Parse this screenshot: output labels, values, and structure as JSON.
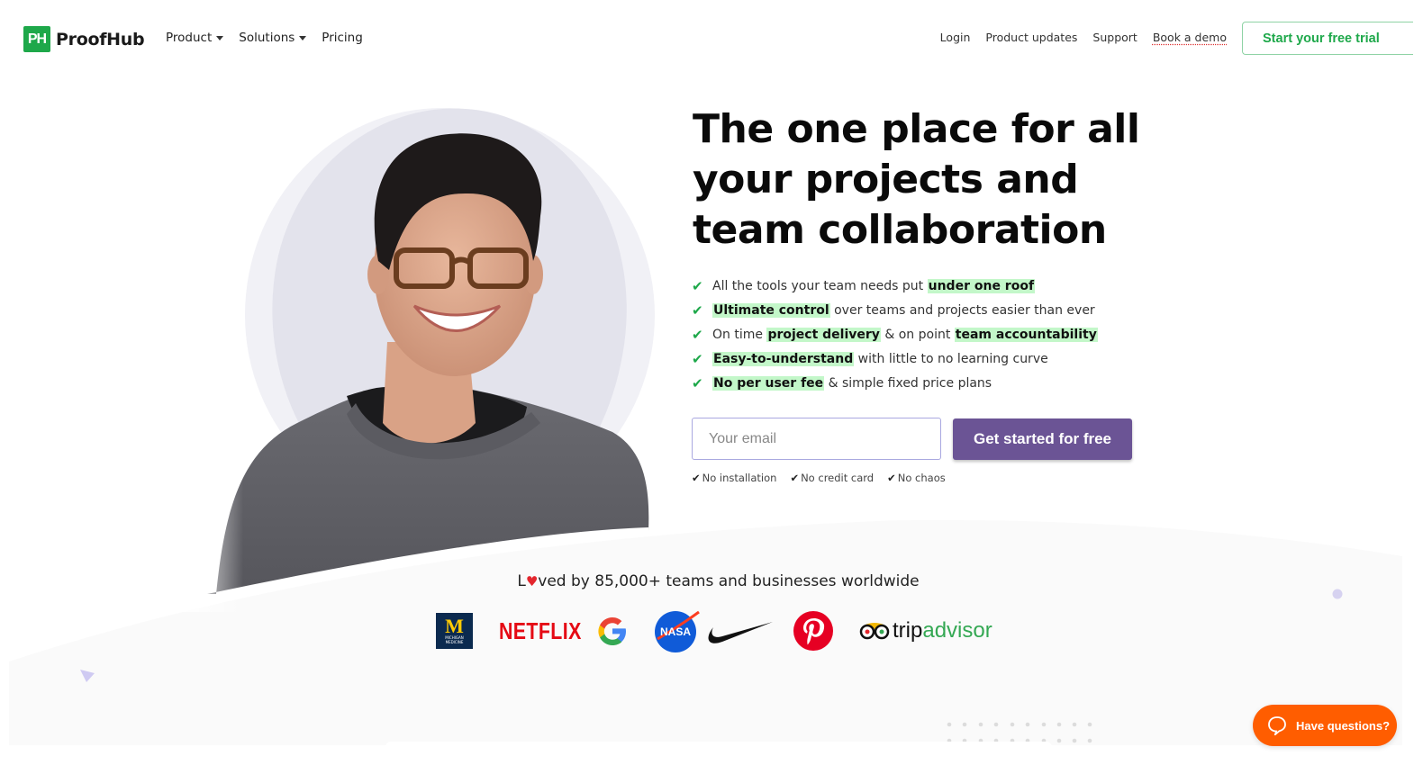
{
  "header": {
    "logo_mark": "PH",
    "logo_text": "ProofHub",
    "nav_left": [
      {
        "label": "Product",
        "has_dropdown": true
      },
      {
        "label": "Solutions",
        "has_dropdown": true
      },
      {
        "label": "Pricing",
        "has_dropdown": false
      }
    ],
    "nav_right": [
      "Login",
      "Product updates",
      "Support",
      "Book a demo"
    ],
    "trial_button": "Start your free trial"
  },
  "hero": {
    "title": "The one place for all your projects and team collaboration",
    "features": [
      [
        {
          "t": "All the tools your team needs put "
        },
        {
          "t": "under one roof",
          "hl": true
        }
      ],
      [
        {
          "t": "Ultimate control",
          "hl": true
        },
        {
          "t": " over teams and projects easier than ever"
        }
      ],
      [
        {
          "t": "On time "
        },
        {
          "t": "project delivery",
          "hl": true
        },
        {
          "t": " & on point "
        },
        {
          "t": "team accountability",
          "hl": true
        }
      ],
      [
        {
          "t": "Easy-to-understand",
          "hl": true
        },
        {
          "t": " with little to no learning curve"
        }
      ],
      [
        {
          "t": "No per user fee",
          "hl": true
        },
        {
          "t": " & simple fixed price plans"
        }
      ]
    ],
    "email_placeholder": "Your email",
    "email_value": "",
    "cta_label": "Get started for free",
    "assurances": [
      "No installation",
      "No credit card",
      "No chaos"
    ]
  },
  "social_proof": {
    "loved_prefix": "L",
    "loved_suffix": "ved by 85,000+ teams and businesses worldwide",
    "logos": [
      "Michigan Medicine",
      "Netflix",
      "Google",
      "NASA",
      "Nike",
      "Pinterest",
      "tripadvisor"
    ],
    "michigan_sub": "MICHIGAN MEDICINE",
    "netflix": "NETFLIX",
    "trip": "trip",
    "advisor": "advisor"
  },
  "chat": {
    "label": "Have questions?"
  },
  "colors": {
    "brand_green": "#1ea84a",
    "highlight": "#c3f7c9",
    "cta_purple": "#6b5495",
    "chat_orange": "#ff5d00"
  }
}
